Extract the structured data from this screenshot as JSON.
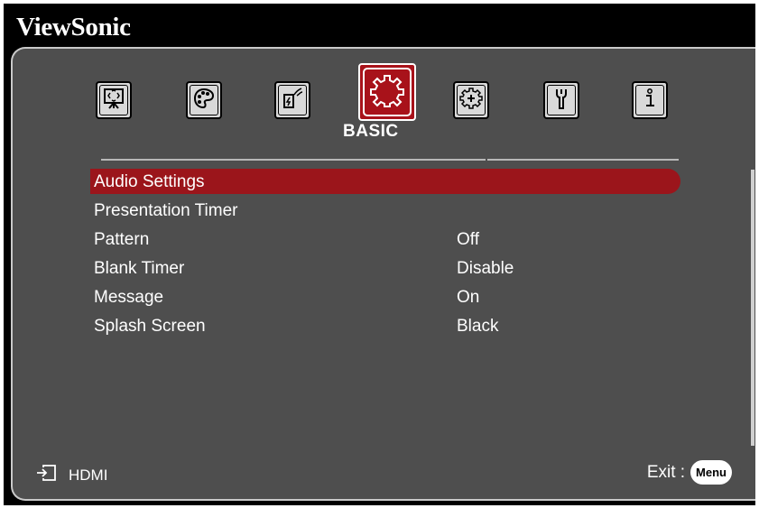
{
  "brand": "ViewSonic",
  "tabs": [
    {
      "icon": "display-icon"
    },
    {
      "icon": "palette-icon"
    },
    {
      "icon": "power-energy-icon"
    },
    {
      "icon": "gear-icon",
      "label": "BASIC",
      "active": true
    },
    {
      "icon": "advanced-gear-icon"
    },
    {
      "icon": "wrench-icon"
    },
    {
      "icon": "info-icon"
    }
  ],
  "menu": {
    "items": [
      {
        "label": "Audio Settings",
        "value": ""
      },
      {
        "label": "Presentation Timer",
        "value": ""
      },
      {
        "label": "Pattern",
        "value": "Off"
      },
      {
        "label": "Blank Timer",
        "value": "Disable"
      },
      {
        "label": "Message",
        "value": "On"
      },
      {
        "label": "Splash Screen",
        "value": "Black"
      }
    ],
    "selected_index": 0
  },
  "footer": {
    "source_icon": "input-source-icon",
    "source": "HDMI",
    "exit_label": "Exit :",
    "menu_button": "Menu"
  },
  "colors": {
    "accent": "#9b151b",
    "panel": "#4e4e4e",
    "background": "#000000"
  }
}
